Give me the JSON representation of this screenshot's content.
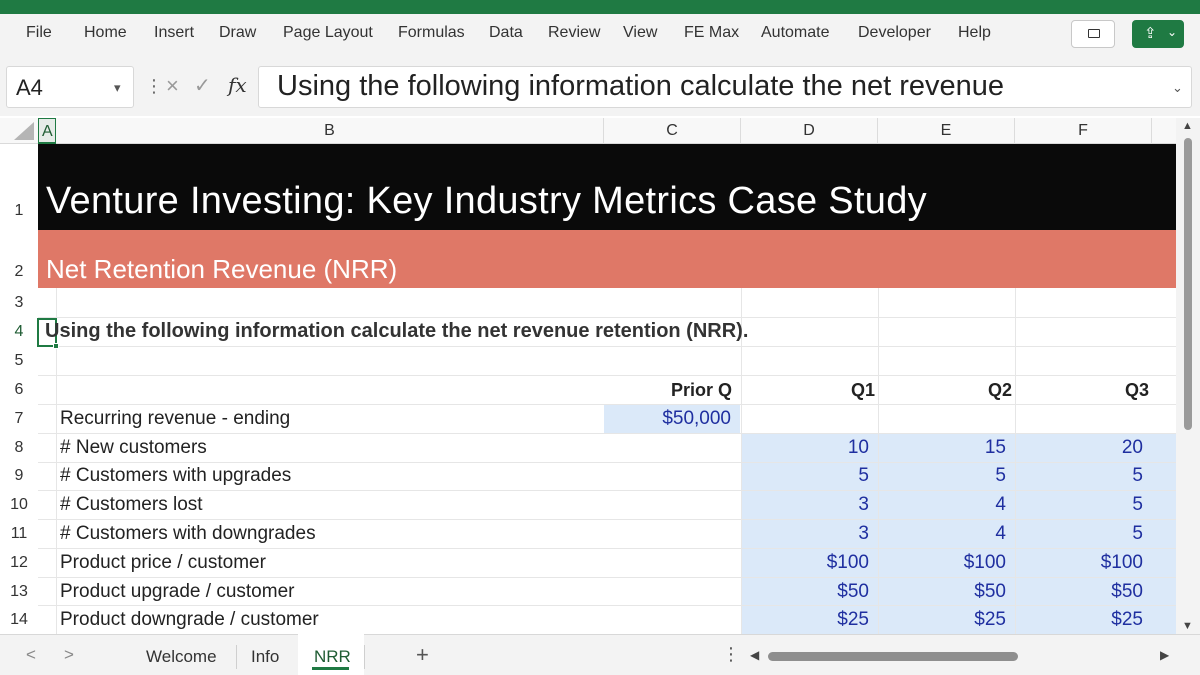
{
  "ribbon": {
    "menu": [
      "File",
      "Home",
      "Insert",
      "Draw",
      "Page Layout",
      "Formulas",
      "Data",
      "Review",
      "View",
      "FE Max",
      "Automate",
      "Developer",
      "Help"
    ]
  },
  "formula_bar": {
    "name_box": "A4",
    "fx_label": "fx",
    "formula": "Using the following information calculate the net revenue"
  },
  "columns": [
    "A",
    "B",
    "C",
    "D",
    "E",
    "F"
  ],
  "rows": [
    "1",
    "2",
    "3",
    "4",
    "5",
    "6",
    "7",
    "8",
    "9",
    "10",
    "11",
    "12",
    "13",
    "14"
  ],
  "sheet": {
    "title": "Venture Investing: Key Industry Metrics Case Study",
    "subtitle": "Net Retention Revenue (NRR)",
    "instruction": "Using the following information calculate the net revenue retention (NRR).",
    "headers": [
      "Prior Q",
      "Q1",
      "Q2",
      "Q3"
    ],
    "row_labels": [
      "Recurring revenue - ending",
      "# New customers",
      "# Customers with upgrades",
      "# Customers lost",
      "# Customers with downgrades",
      "Product price / customer",
      "Product upgrade / customer",
      "Product downgrade / customer"
    ],
    "prior_value": "$50,000",
    "q_values": [
      [
        "10",
        "15",
        "20"
      ],
      [
        "5",
        "5",
        "5"
      ],
      [
        "3",
        "4",
        "5"
      ],
      [
        "3",
        "4",
        "5"
      ],
      [
        "$100",
        "$100",
        "$100"
      ],
      [
        "$50",
        "$50",
        "$50"
      ],
      [
        "$25",
        "$25",
        "$25"
      ]
    ]
  },
  "tabs": {
    "sheets": [
      "Welcome",
      "Info",
      "NRR"
    ],
    "active": "NRR",
    "add": "+"
  },
  "colors": {
    "excel_green": "#1f7a43",
    "title_band": "#0a0a0a",
    "subtitle_band": "#df7867",
    "input_fill": "#dbe9f9",
    "input_text": "#1f2fa0"
  }
}
